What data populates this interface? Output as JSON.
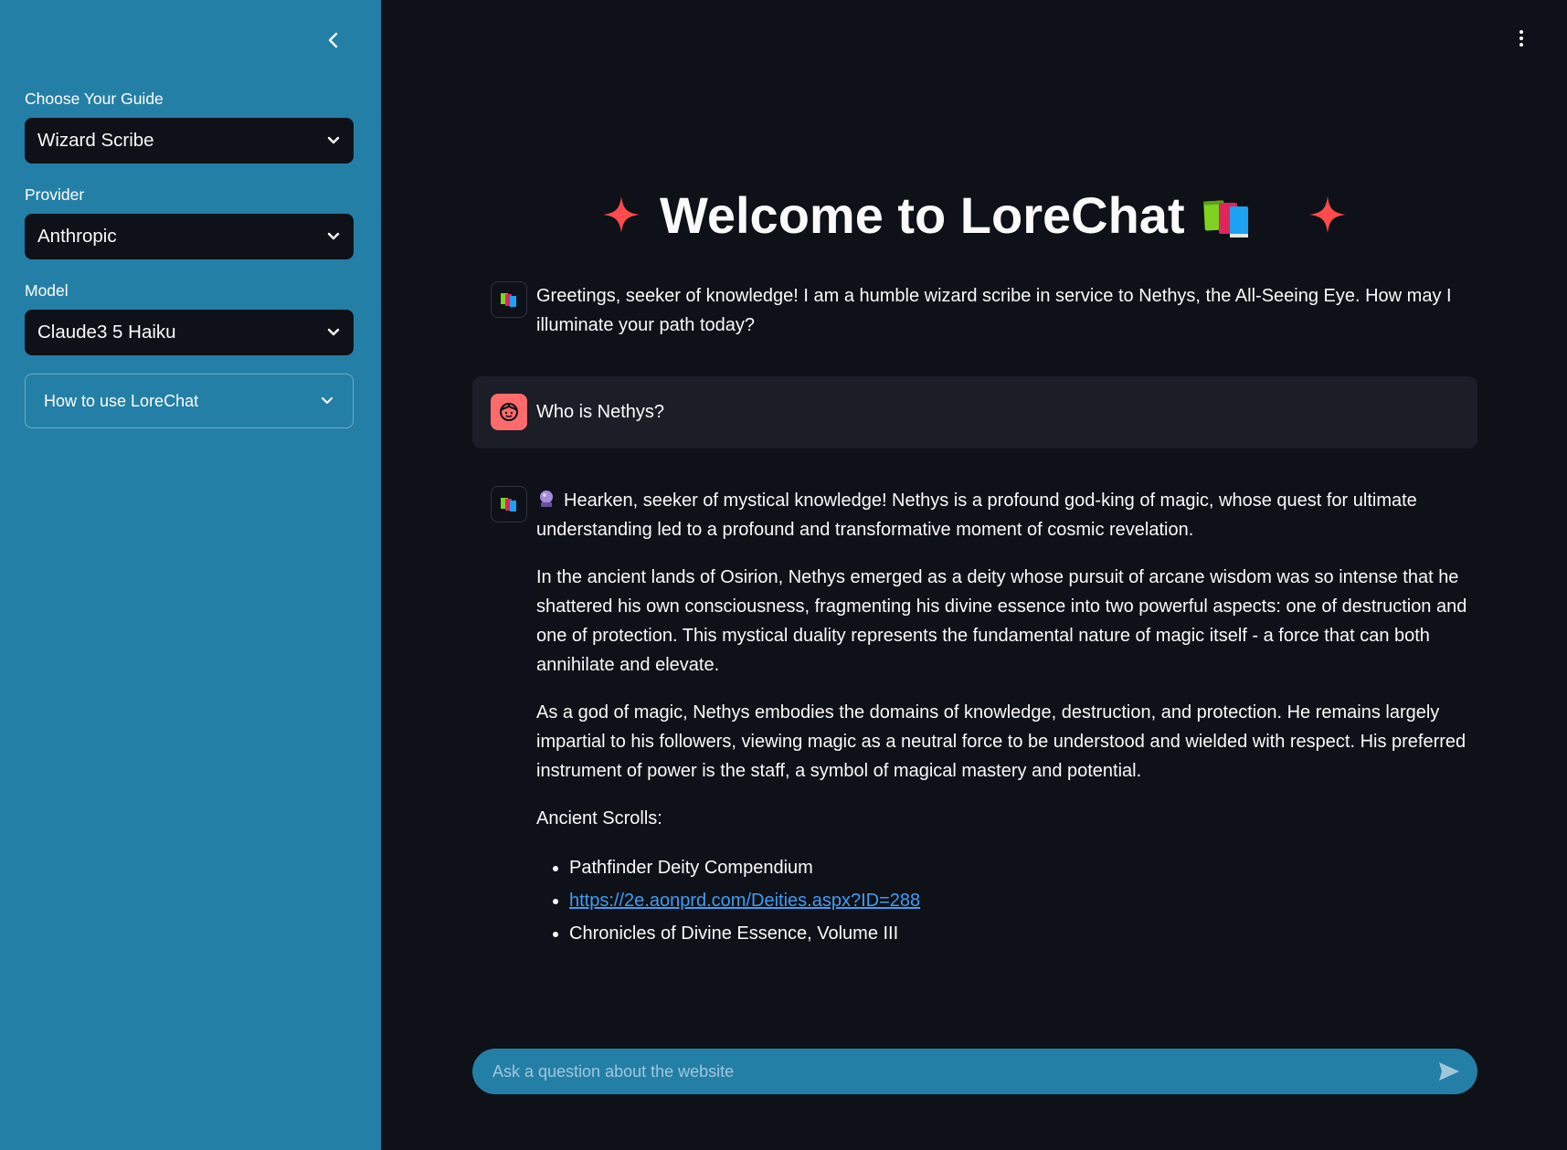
{
  "sidebar": {
    "guide_label": "Choose Your Guide",
    "guide_value": "Wizard Scribe",
    "provider_label": "Provider",
    "provider_value": "Anthropic",
    "model_label": "Model",
    "model_value": "Claude3 5 Haiku",
    "help_expander": "How to use LoreChat"
  },
  "main": {
    "title": "Welcome to LoreChat",
    "messages": [
      {
        "role": "assistant",
        "text": "Greetings, seeker of knowledge! I am a humble wizard scribe in service to Nethys, the All-Seeing Eye. How may I illuminate your path today?"
      },
      {
        "role": "user",
        "text": "Who is Nethys?"
      },
      {
        "role": "assistant",
        "paragraphs": [
          "Hearken, seeker of mystical knowledge! Nethys is a profound god-king of magic, whose quest for ultimate understanding led to a profound and transformative moment of cosmic revelation.",
          "In the ancient lands of Osirion, Nethys emerged as a deity whose pursuit of arcane wisdom was so intense that he shattered his own consciousness, fragmenting his divine essence into two powerful aspects: one of destruction and one of protection. This mystical duality represents the fundamental nature of magic itself - a force that can both annihilate and elevate.",
          "As a god of magic, Nethys embodies the domains of knowledge, destruction, and protection. He remains largely impartial to his followers, viewing magic as a neutral force to be understood and wielded with respect. His preferred instrument of power is the staff, a symbol of magical mastery and potential.",
          "Ancient Scrolls:"
        ],
        "scrolls": [
          "Pathfinder Deity Compendium",
          "https://2e.aonprd.com/Deities.aspx?ID=288",
          "Chronicles of Divine Essence, Volume III"
        ]
      }
    ],
    "input_placeholder": "Ask a question about the website"
  },
  "colors": {
    "sidebar_bg": "#247fa6",
    "main_bg": "#0e1117",
    "accent": "#ff4b4b",
    "user_avatar": "#ff6b6b",
    "link": "#3f9df5"
  },
  "icons": {
    "collapse": "chevron-left-icon",
    "menu": "vertical-ellipsis-icon",
    "dropdown": "chevron-down-icon",
    "sparkle": "sparkle-icon",
    "books": "books-icon",
    "assistant_avatar": "books-icon",
    "user_avatar": "user-face-icon",
    "crystal_ball": "crystal-ball-icon",
    "send": "send-icon"
  }
}
